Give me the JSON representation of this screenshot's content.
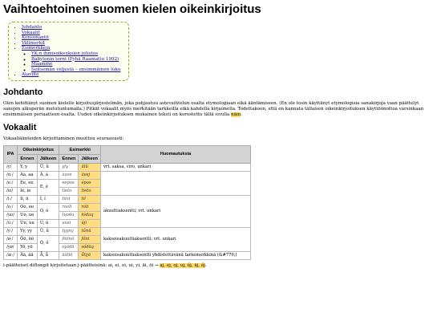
{
  "title": "Vaihtoehtoinen suomen kielen oikeinkirjoitus",
  "toc": {
    "items": [
      "Johdanto",
      "Vokaalit",
      "Konsonantit",
      "Välimerkit",
      "Esimerkkejä"
    ],
    "subitems": [
      "YK:n ihmisoikeuksien julistus",
      "Babylonin torni (Pyhä Raamattu 1992)",
      "Maamme",
      "Seitsemän veljestä – ensimmäinen luku"
    ],
    "last": "Alaviite"
  },
  "intro": {
    "heading": "Johdanto",
    "text": "Olen kehittänyt suomen kielelle kirjoitusjärjestelmän, joka pohjautuu astevaihtelun osalta etymologiaan eikä ääntämiseen. (En ole tosin käyttänyt etymologisia sanakirjoja vaan päättelyt sanojen alkuperän mututuntumalla.) Pitkät vokaalit myös merkitään tarkkeilla eikä kahdella kirjaimella. Todettakoon, että en kannata tällaisen oikeinkirjoituksen käyttöönottoa varsinkaan ensimmäisen periaatteen osalta. Uuden oikeinkirjoituksen mukainen teksti on korostettu tällä sivulla ",
    "highlight": "näin",
    "end": "."
  },
  "vowels": {
    "heading": "Vokaalit",
    "lead": "Vokaaliäänteiden kirjoittaminen muuttuu seuraavasti:",
    "headers": {
      "ipa": "IPA",
      "spelling": "Oikeinkirjoitus",
      "example": "Esimerkki",
      "notes": "Huomautuksia",
      "before": "Ennen",
      "after": "Jälkeen"
    },
    "rows": [
      {
        "ipa": "/y/",
        "before": "Y, y",
        "after": "Ű, ű",
        "ex_before": "yly",
        "ex_after": "ŭlŭ",
        "note": "vrt. saksa, viro, unkari"
      },
      {
        "ipa": "/ɑː/",
        "before": "Aa, aa",
        "after": "Á, á",
        "ex_before": "aave",
        "ex_after": "ávej"
      },
      {
        "ipa": "/eː/",
        "before": "Ee, ee",
        "after": "É, é",
        "ex_before": "eepos",
        "ex_after": "épos"
      },
      {
        "ipa": "/ie/",
        "before": "Ie, ie",
        "after": "",
        "ex_before": "tieto",
        "ex_after": "tieto"
      },
      {
        "ipa": "/iː/",
        "before": "Ii, ii",
        "after": "Í, í",
        "ex_before": "tiivi",
        "ex_after": "tíi",
        "note": "akuuttiaksentti; vrt. unkari"
      },
      {
        "ipa": "/oː/",
        "before": "Oo, oo",
        "after": "Ó, ó",
        "ex_before": "rooli",
        "ex_after": "róli"
      },
      {
        "ipa": "/uo/",
        "before": "Uo, uo",
        "after": "",
        "ex_before": "tuoda",
        "ex_after": "tódaq"
      },
      {
        "ipa": "/uː/",
        "before": "Uu, uu",
        "after": "Ú, ú",
        "ex_before": "uusi",
        "ex_after": "úji"
      },
      {
        "ipa": "/yː/",
        "before": "Yy, yy",
        "after": "Ű, ű",
        "ex_before": "tyyny",
        "ex_after": "tűnű"
      },
      {
        "ipa": "/øː/",
        "before": "Öö, öö",
        "after": "Ő, ő",
        "ex_before": "föönö",
        "ex_after": "főni",
        "note": "kaksoisakuuttiaksentti; vrt. unkari"
      },
      {
        "ipa": "/yø/",
        "before": "Yö, yö",
        "after": "",
        "ex_before": "syödä",
        "ex_after": "sődäq"
      },
      {
        "ipa": "/æː/",
        "before": "Ää, ää",
        "after": "Ǟ, ǟ",
        "ex_before": "äätiö",
        "ex_after": "ǟtijä",
        "note": "kaksoisakuuttiaksentti yhdistettävänä tarkemerkkinä (&#779;)"
      }
    ]
  },
  "footer": {
    "text": "i-päätteiset diftongit kirjoitetaan j-päätteisinä: ai, ei, oi, ui, yi, äi, öi → ",
    "highlight": "aj, ej, oj, uj, űj, äj, őj",
    "end": "."
  }
}
